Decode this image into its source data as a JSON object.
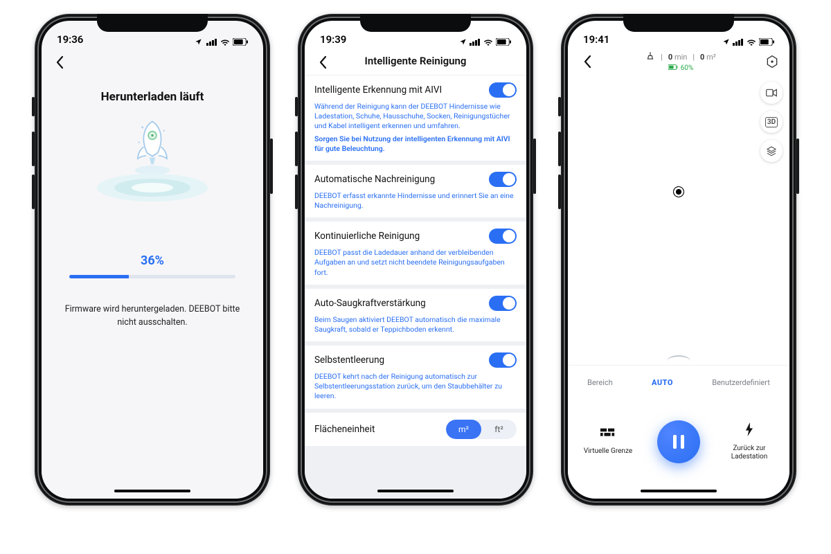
{
  "phone1": {
    "status_time": "19:36",
    "title": "Herunterladen läuft",
    "progress_pct": 36,
    "progress_label": "36%",
    "message": "Firmware wird heruntergeladen. DEEBOT bitte nicht ausschalten."
  },
  "phone2": {
    "status_time": "19:39",
    "header_title": "Intelligente Reinigung",
    "rows": [
      {
        "title": "Intelligente Erkennung mit AIVI",
        "desc": "Während der Reinigung kann der DEEBOT Hindernisse wie Ladestation, Schuhe, Hausschuhe, Socken, Reinigungstücher und Kabel intelligent erkennen und umfahren.",
        "note": "Sorgen Sie bei Nutzung der intelligenten Erkennung mit AIVI für gute Beleuchtung.",
        "on": true
      },
      {
        "title": "Automatische Nachreinigung",
        "desc": "DEEBOT erfasst erkannte Hindernisse und erinnert Sie an eine Nachreinigung.",
        "on": true
      },
      {
        "title": "Kontinuierliche Reinigung",
        "desc": "DEEBOT passt die Ladedauer anhand der verbleibenden Aufgaben an und setzt nicht beendete Reinigungsaufgaben fort.",
        "on": true
      },
      {
        "title": "Auto-Saugkraftverstärkung",
        "desc": "Beim Saugen aktiviert DEEBOT automatisch die maximale Saugkraft, sobald er Teppichboden erkennt.",
        "on": true
      },
      {
        "title": "Selbstentleerung",
        "desc": "DEEBOT kehrt nach der Reinigung automatisch zur Selbstentleerungsstation zurück, um den Staubbehälter zu leeren.",
        "on": true
      }
    ],
    "area_unit_label": "Flächeneinheit",
    "area_unit_m2": "m²",
    "area_unit_ft2": "ft²"
  },
  "phone3": {
    "status_time": "19:41",
    "stats_time_value": "0",
    "stats_time_unit": "min",
    "stats_area_value": "0",
    "stats_area_unit": "m²",
    "battery_label": "60%",
    "modes": {
      "area": "Bereich",
      "auto": "AUTO",
      "custom": "Benutzerdefiniert"
    },
    "actions": {
      "virtual_wall": "Virtuelle Grenze",
      "return_dock": "Zurück zur Ladestation"
    },
    "float_labels": {
      "cam": "cam",
      "three_d": "3D",
      "layers": "layers"
    }
  }
}
